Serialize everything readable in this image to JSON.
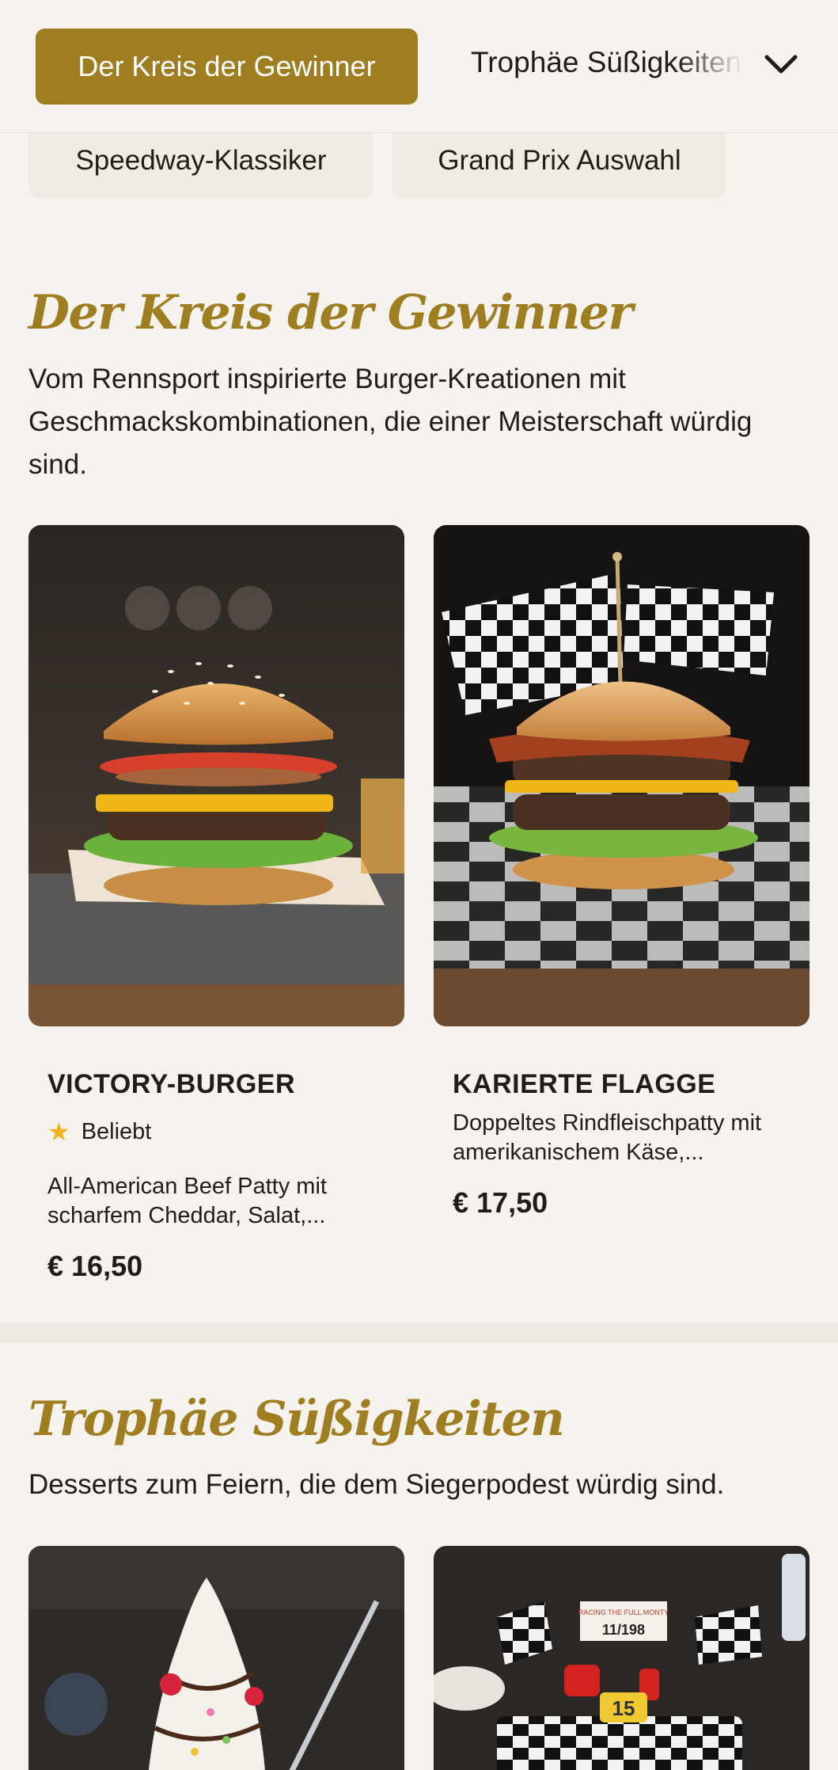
{
  "nav": {
    "active_tab": "Der Kreis der Gewinner",
    "next_tab": "Trophäe Süßigkeiten",
    "chips": [
      "Speedway-Klassiker",
      "Grand Prix Auswahl"
    ]
  },
  "sections": [
    {
      "title": "Der Kreis der Gewinner",
      "description": "Vom Rennsport inspirierte Burger-Kreationen mit Geschmackskombinationen, die einer Meisterschaft würdig sind.",
      "products": [
        {
          "name": "VICTORY-BURGER",
          "badge": "Beliebt",
          "description": "All-American Beef Patty mit scharfem Cheddar, Salat,...",
          "price": "€ 16,50"
        },
        {
          "name": "KARIERTE FLAGGE",
          "description": "Doppeltes Rindfleischpatty mit amerikanischem Käse,...",
          "price": "€ 17,50"
        }
      ]
    },
    {
      "title": "Trophäe Süßigkeiten",
      "description": "Desserts zum Feiern, die dem Siegerpodest würdig sind.",
      "cake_sign": {
        "line1": "RACING THE FULL MONTY",
        "line2": "11/198"
      },
      "cake_number": "15"
    }
  ],
  "colors": {
    "accent": "#9f7d21",
    "background": "#f6f3ee",
    "chip": "#efece3",
    "star": "#f3b21b"
  },
  "icons": {
    "dropdown": "chevron-down-icon",
    "badge": "star-icon"
  }
}
